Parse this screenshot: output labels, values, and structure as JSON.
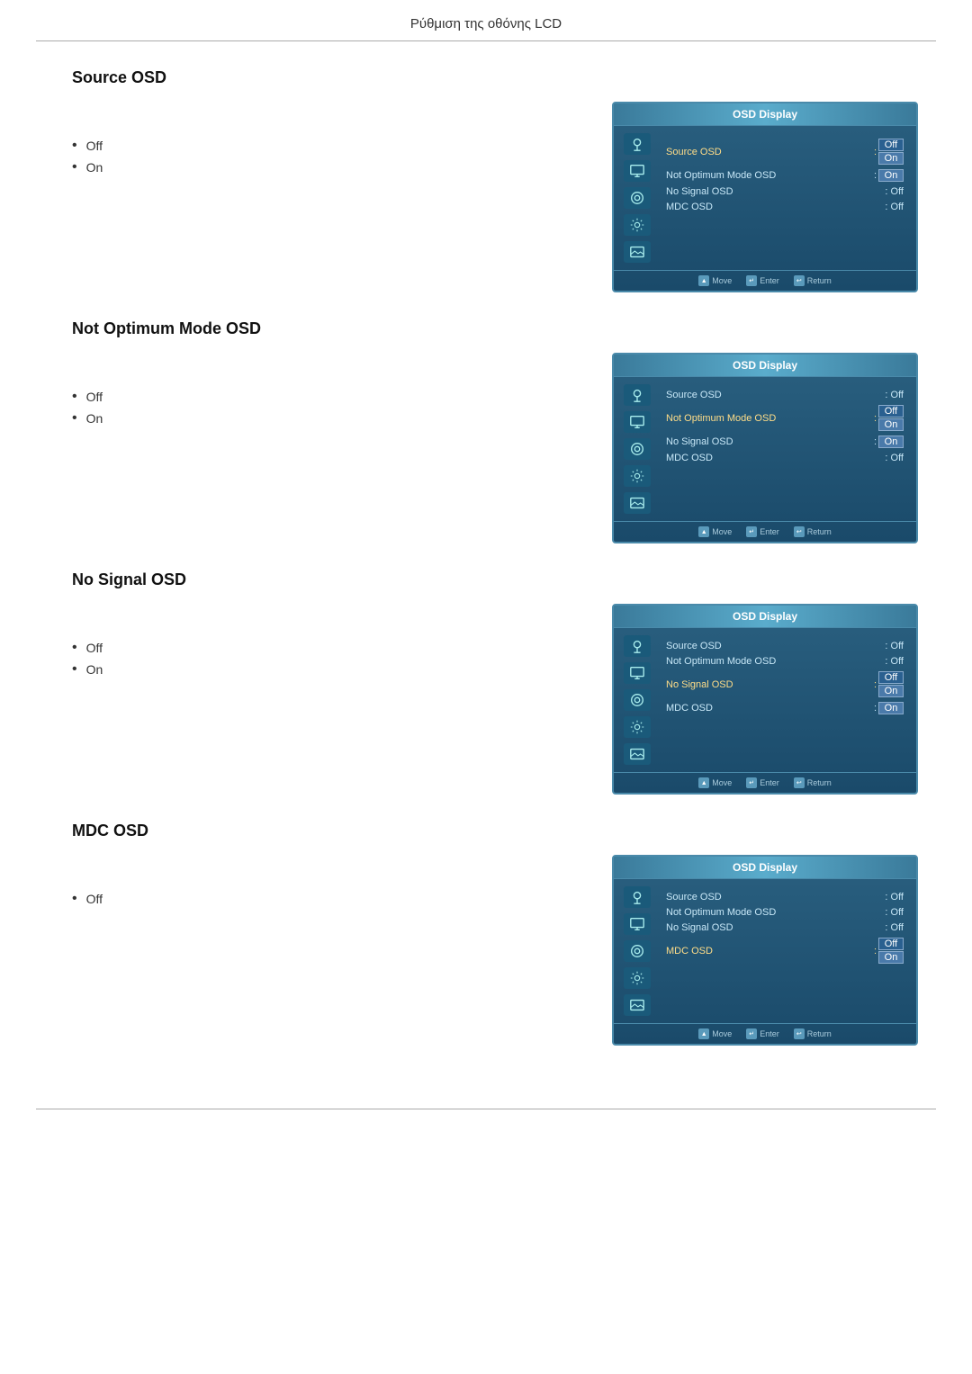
{
  "page": {
    "title": "Ρύθμιση της οθόνης LCD"
  },
  "sections": [
    {
      "id": "source-osd",
      "title": "Source OSD",
      "options": [
        "Off",
        "On"
      ],
      "osd": {
        "title": "OSD Display",
        "rows": [
          {
            "label": "Source OSD",
            "value": "Off",
            "highlighted": true,
            "selectedOff": true,
            "selectedOn": false
          },
          {
            "label": "Not Optimum Mode OSD",
            "value": "On",
            "highlighted": false,
            "selectedOff": false,
            "selectedOn": true
          },
          {
            "label": "No Signal OSD",
            "value": "Off",
            "highlighted": false,
            "selectedOff": false,
            "selectedOn": false
          },
          {
            "label": "MDC OSD",
            "value": "Off",
            "highlighted": false,
            "selectedOff": false,
            "selectedOn": false
          }
        ],
        "footer": [
          "Move",
          "Enter",
          "Return"
        ]
      }
    },
    {
      "id": "not-optimum-mode-osd",
      "title": "Not Optimum Mode OSD",
      "options": [
        "Off",
        "On"
      ],
      "osd": {
        "title": "OSD Display",
        "rows": [
          {
            "label": "Source OSD",
            "value": "Off",
            "highlighted": false,
            "selectedOff": false,
            "selectedOn": false
          },
          {
            "label": "Not Optimum Mode OSD",
            "value": "Off",
            "highlighted": true,
            "selectedOff": true,
            "selectedOn": false
          },
          {
            "label": "No Signal OSD",
            "value": "On",
            "highlighted": false,
            "selectedOff": false,
            "selectedOn": true
          },
          {
            "label": "MDC OSD",
            "value": "Off",
            "highlighted": false,
            "selectedOff": false,
            "selectedOn": false
          }
        ],
        "footer": [
          "Move",
          "Enter",
          "Return"
        ]
      }
    },
    {
      "id": "no-signal-osd",
      "title": "No Signal OSD",
      "options": [
        "Off",
        "On"
      ],
      "osd": {
        "title": "OSD Display",
        "rows": [
          {
            "label": "Source OSD",
            "value": "Off",
            "highlighted": false,
            "selectedOff": false,
            "selectedOn": false
          },
          {
            "label": "Not Optimum Mode OSD",
            "value": "Off",
            "highlighted": false,
            "selectedOff": false,
            "selectedOn": false
          },
          {
            "label": "No Signal OSD",
            "value": "Off",
            "highlighted": true,
            "selectedOff": true,
            "selectedOn": false
          },
          {
            "label": "MDC OSD",
            "value": "On",
            "highlighted": false,
            "selectedOff": false,
            "selectedOn": true
          }
        ],
        "footer": [
          "Move",
          "Enter",
          "Return"
        ]
      }
    },
    {
      "id": "mdc-osd",
      "title": "MDC OSD",
      "options": [
        "Off"
      ],
      "osd": {
        "title": "OSD Display",
        "rows": [
          {
            "label": "Source OSD",
            "value": "Off",
            "highlighted": false,
            "selectedOff": false,
            "selectedOn": false
          },
          {
            "label": "Not Optimum Mode OSD",
            "value": "Off",
            "highlighted": false,
            "selectedOff": false,
            "selectedOn": false
          },
          {
            "label": "No Signal OSD",
            "value": "Off",
            "highlighted": false,
            "selectedOff": false,
            "selectedOn": false
          },
          {
            "label": "MDC OSD",
            "value": "Off",
            "highlighted": true,
            "selectedOff": true,
            "selectedOn": false
          }
        ],
        "footer": [
          "Move",
          "Enter",
          "Return"
        ]
      }
    }
  ]
}
